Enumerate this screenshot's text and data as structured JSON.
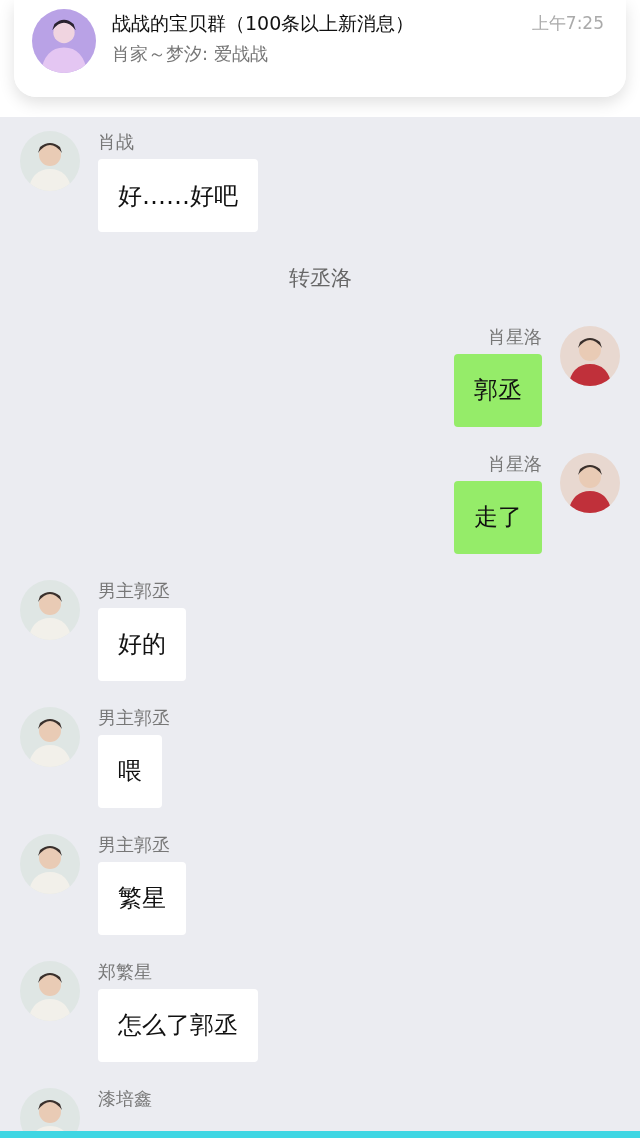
{
  "notification": {
    "title": "战战的宝贝群（100条以上新消息）",
    "preview": "肖家～梦汐: 爱战战",
    "time": "上午7:25"
  },
  "messages": [
    {
      "kind": "received",
      "sender": "肖战",
      "text": "好……好吧"
    },
    {
      "kind": "system",
      "text": "转丞洛"
    },
    {
      "kind": "sent",
      "sender": "肖星洛",
      "text": "郭丞"
    },
    {
      "kind": "sent",
      "sender": "肖星洛",
      "text": "走了"
    },
    {
      "kind": "received",
      "sender": "男主郭丞",
      "text": "好的"
    },
    {
      "kind": "received",
      "sender": "男主郭丞",
      "text": "喂"
    },
    {
      "kind": "received",
      "sender": "男主郭丞",
      "text": "繁星"
    },
    {
      "kind": "received",
      "sender": "郑繁星",
      "text": "怎么了郭丞"
    },
    {
      "kind": "received",
      "sender": "漆培鑫"
    }
  ]
}
